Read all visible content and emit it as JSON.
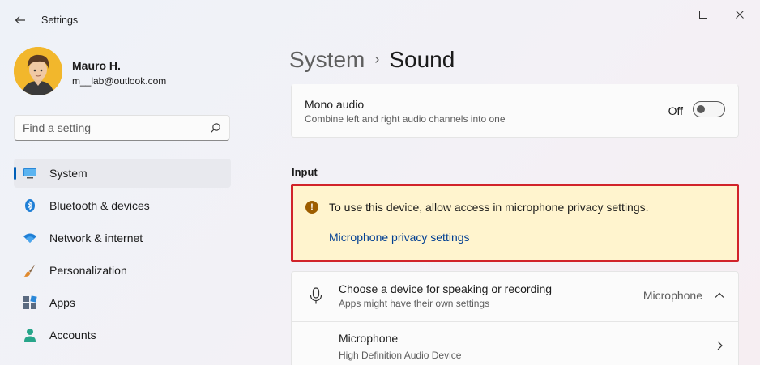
{
  "window": {
    "title": "Settings"
  },
  "user": {
    "name": "Mauro H.",
    "email": "m__lab@outlook.com"
  },
  "search": {
    "placeholder": "Find a setting"
  },
  "sidebar": {
    "items": [
      {
        "label": "System",
        "icon": "system-display-icon",
        "selected": true
      },
      {
        "label": "Bluetooth & devices",
        "icon": "bluetooth-icon"
      },
      {
        "label": "Network & internet",
        "icon": "wifi-icon"
      },
      {
        "label": "Personalization",
        "icon": "brush-icon"
      },
      {
        "label": "Apps",
        "icon": "apps-icon"
      },
      {
        "label": "Accounts",
        "icon": "person-icon"
      }
    ]
  },
  "breadcrumb": {
    "parent": "System",
    "separator": "›",
    "current": "Sound"
  },
  "mono_audio": {
    "title": "Mono audio",
    "description": "Combine left and right audio channels into one",
    "state_label": "Off",
    "enabled": false
  },
  "input_section": {
    "label": "Input",
    "alert": {
      "message": "To use this device, allow access in microphone privacy settings.",
      "link": "Microphone privacy settings"
    },
    "device_chooser": {
      "title": "Choose a device for speaking or recording",
      "description": "Apps might have their own settings",
      "value": "Microphone"
    },
    "device": {
      "name": "Microphone",
      "description": "High Definition Audio Device"
    }
  },
  "colors": {
    "accent": "#005fb8",
    "alert_background": "#fff4ce",
    "alert_border": "#d1232a",
    "link": "#003e92"
  }
}
